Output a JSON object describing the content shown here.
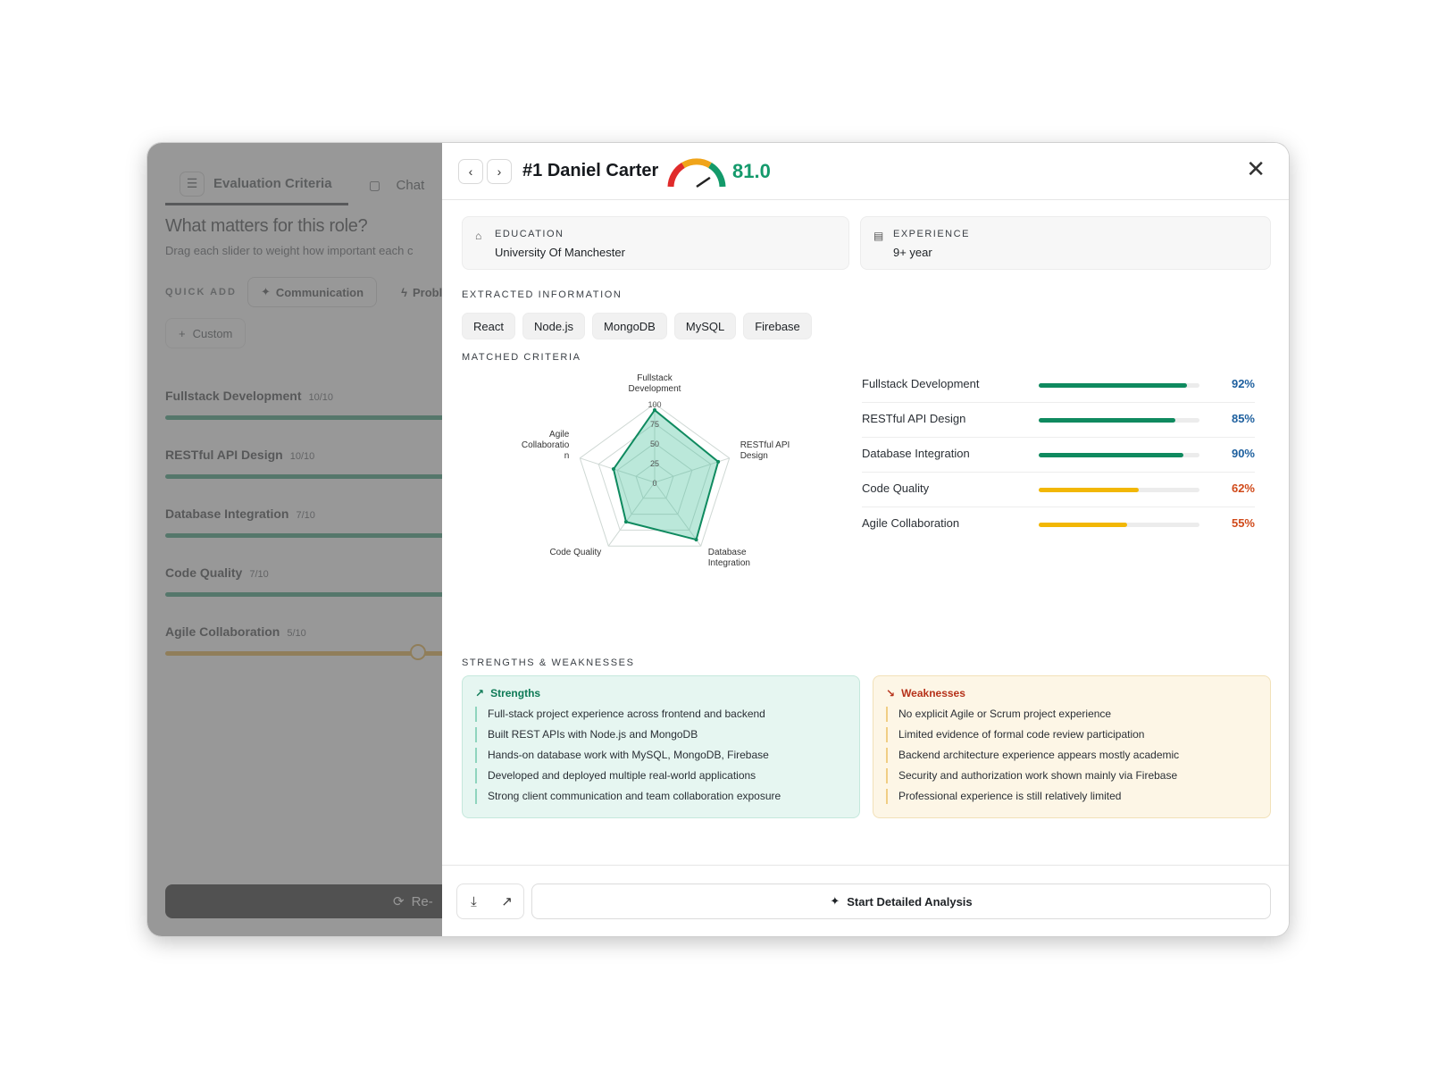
{
  "left": {
    "tabs": [
      {
        "label": "Evaluation Criteria",
        "icon": "sliders-icon"
      },
      {
        "label": "Chat",
        "icon": "chat-icon"
      }
    ],
    "heading": "What matters for this role?",
    "subheading": "Drag each slider to weight how important each c",
    "quick_add": {
      "label": "QUICK ADD",
      "chips": [
        "Communication",
        "Proble"
      ]
    },
    "custom_label": "Custom",
    "criteria": [
      {
        "name": "Fullstack Development",
        "score": "10/10",
        "level": 1.0
      },
      {
        "name": "RESTful API Design",
        "score": "10/10",
        "level": 1.0
      },
      {
        "name": "Database Integration",
        "score": "7/10",
        "level": 0.7
      },
      {
        "name": "Code Quality",
        "score": "7/10",
        "level": 0.7
      },
      {
        "name": "Agile Collaboration",
        "score": "5/10",
        "level": 0.5
      }
    ],
    "rerun_label": "Re-"
  },
  "candidate": {
    "rank": "#1",
    "name": "Daniel Carter",
    "score": "81.0",
    "score_value": 81.0
  },
  "education": {
    "label": "EDUCATION",
    "value": "University Of Manchester"
  },
  "experience": {
    "label": "EXPERIENCE",
    "value": "9+ year"
  },
  "extracted": {
    "label": "EXTRACTED INFORMATION",
    "skills": [
      "React",
      "Node.js",
      "MongoDB",
      "MySQL",
      "Firebase"
    ]
  },
  "matched": {
    "label": "MATCHED CRITERIA"
  },
  "chart_data": {
    "type": "radar",
    "categories": [
      "Fullstack Development",
      "RESTful API Design",
      "Database Integration",
      "Code Quality",
      "Agile Collaboration"
    ],
    "axis_labels": [
      [
        "Fullstack",
        "Development"
      ],
      [
        "RESTful API",
        "Design"
      ],
      [
        "Database",
        "Integration"
      ],
      [
        "Code Quality"
      ],
      [
        "Agile",
        "Collaboratio",
        "n"
      ]
    ],
    "values": [
      92,
      85,
      90,
      62,
      55
    ],
    "ticks": [
      "0",
      "25",
      "50",
      "75",
      "100"
    ],
    "ylim": [
      0,
      100
    ],
    "bars": [
      {
        "label": "Fullstack Development",
        "value": 92,
        "pct": "92%"
      },
      {
        "label": "RESTful API Design",
        "value": 85,
        "pct": "85%"
      },
      {
        "label": "Database Integration",
        "value": 90,
        "pct": "90%"
      },
      {
        "label": "Code Quality",
        "value": 62,
        "pct": "62%"
      },
      {
        "label": "Agile Collaboration",
        "value": 55,
        "pct": "55%"
      }
    ]
  },
  "sw": {
    "label": "STRENGTHS & WEAKNESSES",
    "strengths_title": "Strengths",
    "strengths": [
      "Full-stack project experience across frontend and backend",
      "Built REST APIs with Node.js and MongoDB",
      "Hands-on database work with MySQL, MongoDB, Firebase",
      "Developed and deployed multiple real-world applications",
      "Strong client communication and team collaboration exposure"
    ],
    "weaknesses_title": "Weaknesses",
    "weaknesses": [
      "No explicit Agile or Scrum project experience",
      "Limited evidence of formal code review participation",
      "Backend architecture experience appears mostly academic",
      "Security and authorization work shown mainly via Firebase",
      "Professional experience is still relatively limited"
    ]
  },
  "footer": {
    "analysis_label": "Start Detailed Analysis"
  },
  "colors": {
    "green": "#0f8a5f",
    "amber": "#f2b705",
    "red_text": "#d04a1a",
    "blue_text": "#1d5f9e"
  }
}
